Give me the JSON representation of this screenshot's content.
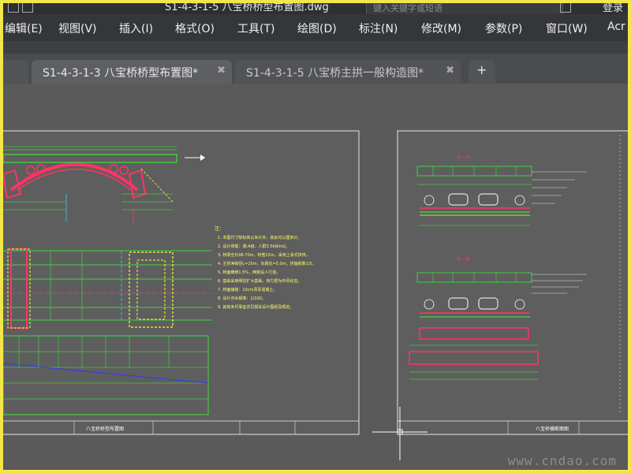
{
  "titlebar": {
    "title": "S1-4-3-1-5 八宝桥桥型布置图.dwg",
    "search_placeholder": "键入关键字或短语",
    "user_label": "登录"
  },
  "menubar": {
    "items": [
      "编辑(E)",
      "视图(V)",
      "插入(I)",
      "格式(O)",
      "工具(T)",
      "绘图(D)",
      "标注(N)",
      "修改(M)",
      "参数(P)",
      "窗口(W)",
      "Acr"
    ]
  },
  "tabs": {
    "items": [
      {
        "label": "S1-4-3-1-3 八宝桥桥型布置图*",
        "active": true
      },
      {
        "label": "S1-4-3-1-5 八宝桥主拱一般构造图*",
        "active": false
      }
    ],
    "add_label": "+"
  },
  "drawing": {
    "sheet1_title": "八宝桥桥型布置图",
    "sheet2_title": "八宝桥横断面图",
    "section_a": "A—A",
    "section_b": "B—B",
    "notes_lines": [
      "注：",
      "1. 本图尺寸除标高以米计外，其余均以厘米计。",
      "2. 设计荷载：城-A级，人群3.5kN/m2。",
      "3. 桥梁全长98.70m，桥宽15m，采用上承式拱桥。",
      "4. 主拱净跨径L=25m，矢跨比=5.0m，拱轴系数1/5。",
      "5. 桥面横坡1.5%，两侧设人行道。",
      "6. 基础采用明挖扩大基础，持力层为中风化岩。",
      "7. 桥面铺装：10cm沥青混凝土。",
      "8. 设计洪水频率：1/100。",
      "9. 其他未尽事宜详见相关设计图纸及规范。"
    ]
  },
  "watermark": "www.cndao.com",
  "colors": {
    "frame": "#f2e64a",
    "canvas": "#5a5a5a",
    "menubar": "#34363a",
    "tab_active": "#5e5f62",
    "tab_inactive": "#525356"
  }
}
